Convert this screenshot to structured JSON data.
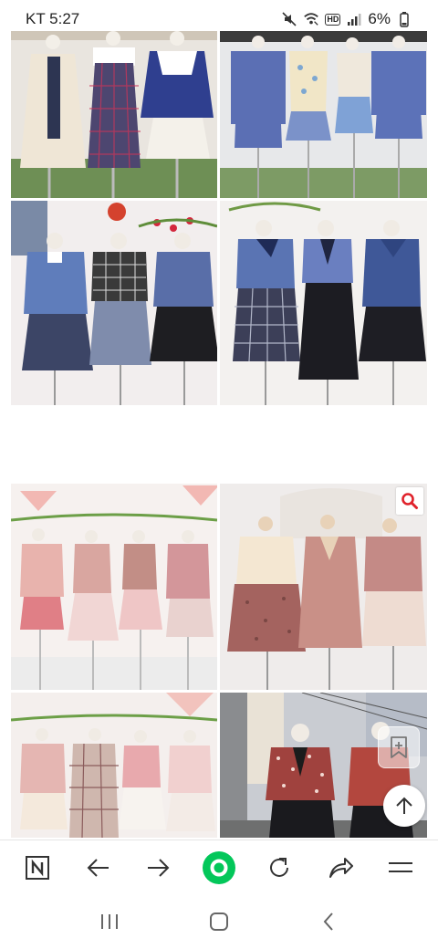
{
  "status_bar": {
    "time": "KT 5:27",
    "battery": "6%",
    "hd_badge": "HD",
    "icons": [
      "mute-icon",
      "wifi-icon",
      "hd-icon",
      "signal-icon",
      "battery-icon"
    ]
  },
  "images": [
    {
      "id": "outfit-photo-1",
      "palette": "cream-navy-plaid"
    },
    {
      "id": "outfit-photo-2",
      "palette": "periwinkle-blue"
    },
    {
      "id": "outfit-photo-3",
      "palette": "blue-black-lace"
    },
    {
      "id": "outfit-photo-4",
      "palette": "blue-plaid-black"
    },
    {
      "id": "outfit-photo-5",
      "palette": "dusty-pink"
    },
    {
      "id": "outfit-photo-6",
      "palette": "mauve-rose"
    },
    {
      "id": "outfit-photo-7",
      "palette": "pink-plaid"
    },
    {
      "id": "outfit-photo-8",
      "palette": "polka-dot-black"
    }
  ],
  "overlays": {
    "zoom_icon": "search-icon",
    "bookmark_icon": "bookmark-plus-icon",
    "scroll_top_icon": "arrow-up-icon"
  },
  "toolbar": {
    "items": [
      "naver-home-icon",
      "back-arrow-icon",
      "forward-arrow-icon",
      "green-dot-icon",
      "refresh-icon",
      "share-icon",
      "menu-icon"
    ],
    "accent": "#03c75a"
  },
  "system_nav": {
    "items": [
      "recent-apps-icon",
      "home-icon",
      "back-icon"
    ]
  }
}
